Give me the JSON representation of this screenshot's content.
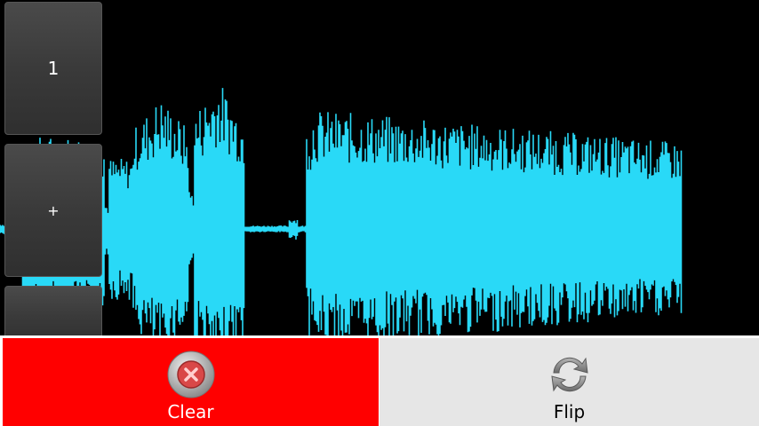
{
  "side_buttons": {
    "top_label": "1",
    "middle_label": "+",
    "bottom_label": ""
  },
  "actions": {
    "clear": {
      "label": "Clear",
      "icon": "clear-x-icon",
      "color": "#ff0000"
    },
    "flip": {
      "label": "Flip",
      "icon": "refresh-arrows-icon",
      "color": "#e6e6e6"
    }
  },
  "colors": {
    "waveform": "#29d9f7",
    "background": "#000000"
  }
}
